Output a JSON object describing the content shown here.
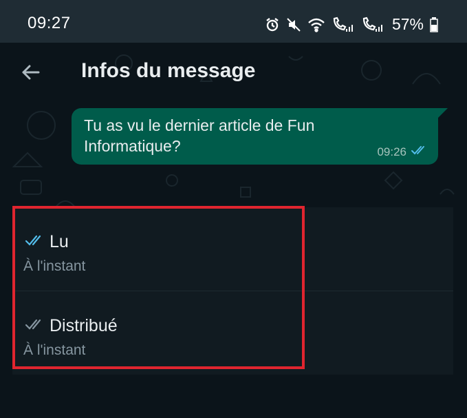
{
  "status_bar": {
    "time": "09:27",
    "icons": [
      "alarm-icon",
      "mute-icon",
      "wifi-icon",
      "call-sim1-icon",
      "signal-icon",
      "call-sim2-icon",
      "signal-icon",
      "battery-icon"
    ],
    "battery": "57%"
  },
  "header": {
    "back_icon": "arrow-left-icon",
    "title": "Infos du message"
  },
  "message": {
    "text": "Tu as vu le dernier article de Fun Informatique?",
    "time": "09:26",
    "status_icon": "double-check-icon",
    "bubble_color": "#005c4b"
  },
  "receipts": [
    {
      "label": "Lu",
      "time": "À l'instant",
      "icon": "double-check-blue-icon",
      "icon_color": "#53bdeb"
    },
    {
      "label": "Distribué",
      "time": "À l'instant",
      "icon": "double-check-grey-icon",
      "icon_color": "#8696a0"
    }
  ],
  "colors": {
    "background": "#0b141a",
    "card": "#111b21",
    "highlight": "#e0252f"
  }
}
